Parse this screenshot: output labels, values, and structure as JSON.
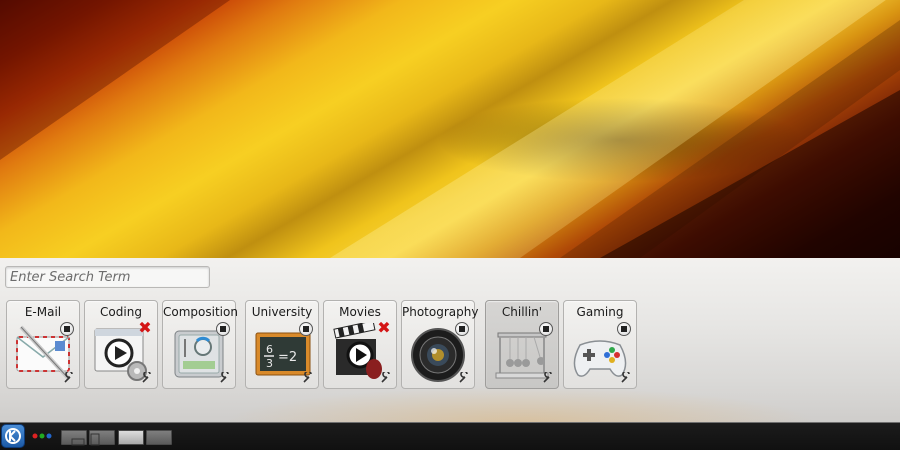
{
  "search": {
    "placeholder": "Enter Search Term"
  },
  "activities": [
    {
      "label": "E-Mail",
      "icon": "mail-envelope-icon",
      "state": "running",
      "control": "stop"
    },
    {
      "label": "Coding",
      "icon": "media-player-gear-icon",
      "state": "running",
      "control": "remove"
    },
    {
      "label": "Composition",
      "icon": "audio-mixer-icon",
      "state": "running",
      "control": "stop"
    },
    {
      "label": "University",
      "icon": "chalkboard-icon",
      "state": "running",
      "control": "stop"
    },
    {
      "label": "Movies",
      "icon": "clapperboard-icon",
      "state": "running",
      "control": "remove"
    },
    {
      "label": "Photography",
      "icon": "camera-lens-icon",
      "state": "running",
      "control": "stop"
    },
    {
      "label": "Chillin'",
      "icon": "newtons-cradle-icon",
      "state": "current",
      "control": "stop"
    },
    {
      "label": "Gaming",
      "icon": "gamepad-icon",
      "state": "running",
      "control": "stop"
    }
  ],
  "colors": {
    "panel": "#e4e3e1",
    "remove": "#d41515",
    "kde_blue": "#2a6fc0"
  },
  "taskbar": {
    "menu_icon": "kde-logo-icon",
    "activity_switcher_icon": "activity-dots-icon",
    "pager": {
      "desktops": 4,
      "current": 3
    }
  }
}
